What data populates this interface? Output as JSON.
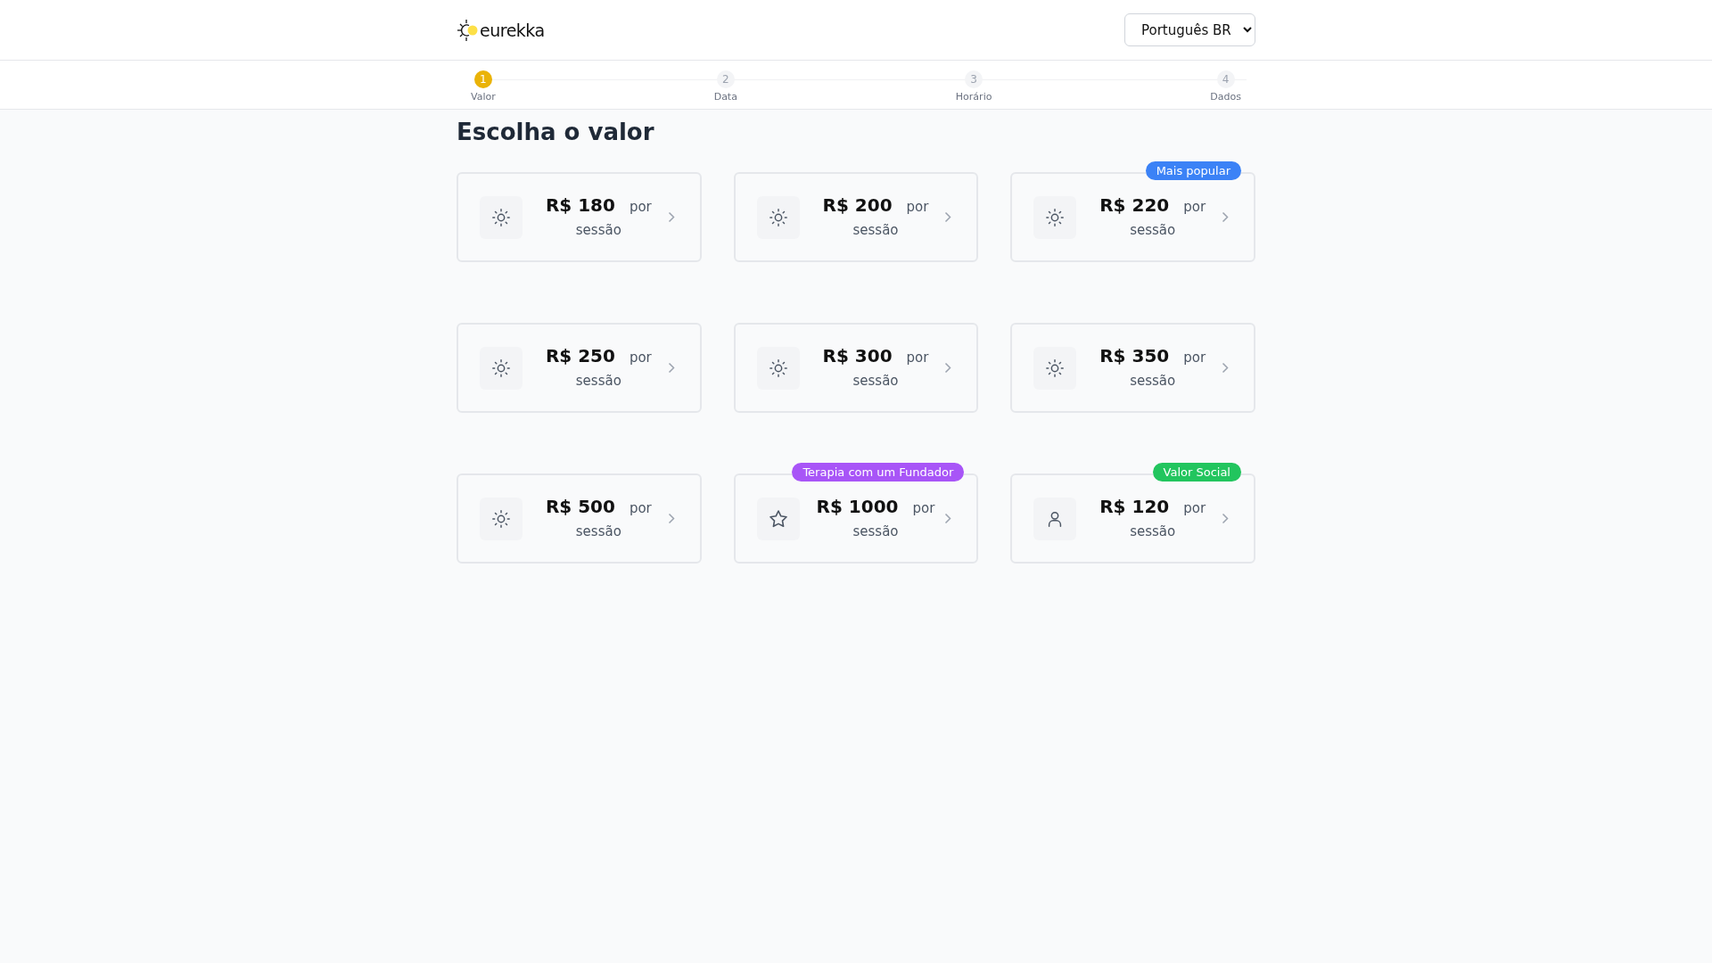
{
  "header": {
    "logo": "eurekka",
    "language": "Português BR"
  },
  "steps": [
    {
      "number": "1",
      "label": "Valor",
      "selected": true
    },
    {
      "number": "2",
      "label": "Data",
      "selected": false
    },
    {
      "number": "3",
      "label": "Horário",
      "selected": false
    },
    {
      "number": "4",
      "label": "Dados",
      "selected": false
    }
  ],
  "title": "Escolha o valor",
  "options": [
    {
      "kind": "sun",
      "price": "R$ 180",
      "per": "por",
      "unit": "sessão"
    },
    {
      "kind": "sun",
      "price": "R$ 200",
      "per": "por",
      "unit": "sessão"
    },
    {
      "kind": "sun",
      "price": "R$ 220",
      "per": "por",
      "unit": "sessão",
      "badge": {
        "text": "Mais popular",
        "color": "#3b82f6"
      }
    },
    {
      "kind": "sun",
      "price": "R$ 250",
      "per": "por",
      "unit": "sessão"
    },
    {
      "kind": "sun",
      "price": "R$ 300",
      "per": "por",
      "unit": "sessão"
    },
    {
      "kind": "sun",
      "price": "R$ 350",
      "per": "por",
      "unit": "sessão"
    },
    {
      "kind": "sun",
      "price": "R$ 500",
      "per": "por",
      "unit": "sessão"
    },
    {
      "kind": "star",
      "price": "R$ 1000",
      "per": "por",
      "unit": "sessão",
      "badge": {
        "text": "Terapia com um Fundador",
        "color": "#a855f7"
      }
    },
    {
      "kind": "person",
      "price": "R$ 120",
      "per": "por",
      "unit": "sessão",
      "badge": {
        "text": "Valor Social",
        "color": "#22c55e"
      }
    }
  ]
}
